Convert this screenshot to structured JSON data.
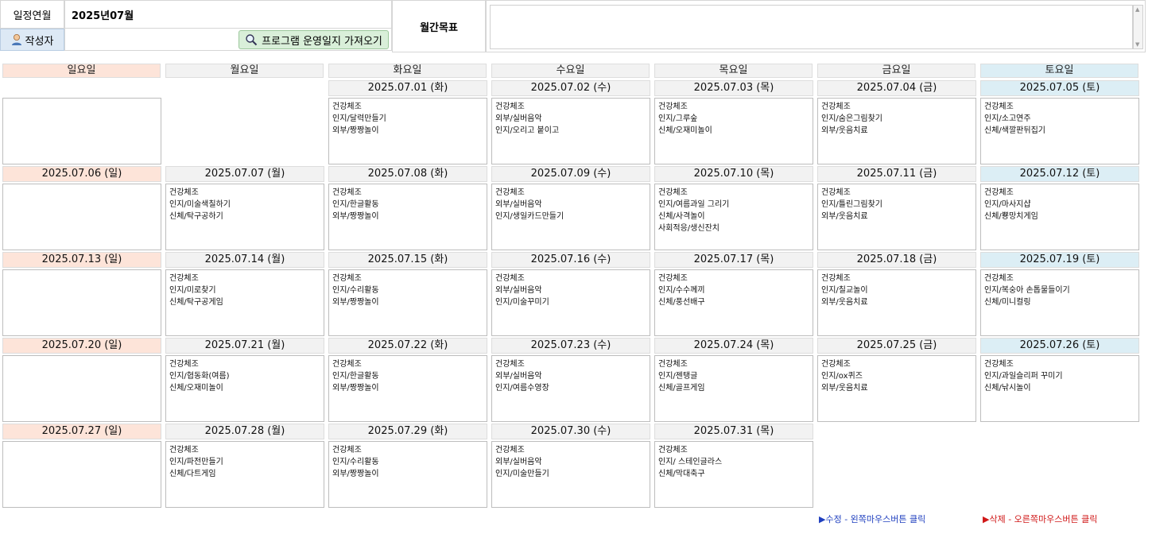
{
  "header": {
    "month_label": "일정연월",
    "month_value": "2025년07월",
    "author_button": "작성자",
    "author_value": "",
    "import_button": "프로그램 운영일지 가져오기",
    "goal_label": "월간목표",
    "goal_value": ""
  },
  "weekdays": [
    "일요일",
    "월요일",
    "화요일",
    "수요일",
    "목요일",
    "금요일",
    "토요일"
  ],
  "weeks": [
    [
      {
        "date": "",
        "items": []
      },
      {
        "date": "",
        "items": []
      },
      {
        "date": "2025.07.01 (화)",
        "items": [
          "건강체조",
          "인지/달력만들기",
          "외부/짱짱놀이"
        ]
      },
      {
        "date": "2025.07.02 (수)",
        "items": [
          "건강체조",
          "외부/실버음악",
          "인지/오리고 붙이고"
        ]
      },
      {
        "date": "2025.07.03 (목)",
        "items": [
          "건강체조",
          "인지/그루숲",
          "신체/오재미놀이"
        ]
      },
      {
        "date": "2025.07.04 (금)",
        "items": [
          "건강체조",
          "인지/숨은그림찾기",
          "외부/웃음치료"
        ]
      },
      {
        "date": "2025.07.05 (토)",
        "items": [
          "건강체조",
          "인지/소고연주",
          "신체/색깔판뒤집기"
        ]
      }
    ],
    [
      {
        "date": "2025.07.06 (일)",
        "items": []
      },
      {
        "date": "2025.07.07 (월)",
        "items": [
          "건강체조",
          "인지/미술색칠하기",
          "신체/탁구공하기"
        ]
      },
      {
        "date": "2025.07.08 (화)",
        "items": [
          "건강체조",
          "인지/한글활동",
          "외부/짱짱놀이"
        ]
      },
      {
        "date": "2025.07.09 (수)",
        "items": [
          "건강체조",
          "외부/실버음악",
          "인지/생일카드만들기"
        ]
      },
      {
        "date": "2025.07.10 (목)",
        "items": [
          "건강체조",
          "인지/여름과일 그리기",
          "신체/사격놀이",
          "사회적응/생신잔치"
        ]
      },
      {
        "date": "2025.07.11 (금)",
        "items": [
          "건강체조",
          "인지/틀린그림찾기",
          "외부/웃음치료"
        ]
      },
      {
        "date": "2025.07.12 (토)",
        "items": [
          "건강체조",
          "인지/마사지샵",
          "신체/뿅망치게임"
        ]
      }
    ],
    [
      {
        "date": "2025.07.13 (일)",
        "items": []
      },
      {
        "date": "2025.07.14 (월)",
        "items": [
          "건강체조",
          "인지/미로찾기",
          "신체/탁구공게임"
        ]
      },
      {
        "date": "2025.07.15 (화)",
        "items": [
          "건강체조",
          "인지/수리활동",
          "외부/짱짱놀이"
        ]
      },
      {
        "date": "2025.07.16 (수)",
        "items": [
          "건강체조",
          "외부/실버음악",
          "인지/미술꾸미기"
        ]
      },
      {
        "date": "2025.07.17 (목)",
        "items": [
          "건강체조",
          "인지/수수께끼",
          "신체/풍선배구"
        ]
      },
      {
        "date": "2025.07.18 (금)",
        "items": [
          "건강체조",
          "인지/칠교놀이",
          "외부/웃음치료"
        ]
      },
      {
        "date": "2025.07.19 (토)",
        "items": [
          "건강체조",
          "인지/복숭아 손톱물들이기",
          "신체/미니컬링"
        ]
      }
    ],
    [
      {
        "date": "2025.07.20 (일)",
        "items": []
      },
      {
        "date": "2025.07.21 (월)",
        "items": [
          "건강체조",
          "인지/협동화(여름)",
          "신체/오재미놀이"
        ]
      },
      {
        "date": "2025.07.22 (화)",
        "items": [
          "건강체조",
          "인지/한글활동",
          "외부/짱짱놀이"
        ]
      },
      {
        "date": "2025.07.23 (수)",
        "items": [
          "건강체조",
          "외부/실버음악",
          "인지/여름수영장"
        ]
      },
      {
        "date": "2025.07.24 (목)",
        "items": [
          "건강체조",
          "인지/젠탱글",
          "신체/골프게임"
        ]
      },
      {
        "date": "2025.07.25 (금)",
        "items": [
          "건강체조",
          "인지/ox퀴즈",
          "외부/웃음치료"
        ]
      },
      {
        "date": "2025.07.26 (토)",
        "items": [
          "건강체조",
          "인지/과일슬리퍼 꾸미기",
          "신체/낚시놀이"
        ]
      }
    ],
    [
      {
        "date": "2025.07.27 (일)",
        "items": []
      },
      {
        "date": "2025.07.28 (월)",
        "items": [
          "건강체조",
          "인지/파전만들기",
          "신체/다트게임"
        ]
      },
      {
        "date": "2025.07.29 (화)",
        "items": [
          "건강체조",
          "인지/수리활동",
          "외부/짱짱놀이"
        ]
      },
      {
        "date": "2025.07.30 (수)",
        "items": [
          "건강체조",
          "외부/실버음악",
          "인지/미술만들기"
        ]
      },
      {
        "date": "2025.07.31 (목)",
        "items": [
          "건강체조",
          "인지/ 스테인글라스",
          "신체/막대축구"
        ]
      }
    ]
  ],
  "footer": {
    "edit_hint": "수정 - 왼쪽마우스버튼 클릭",
    "delete_hint": "삭제 - 오른쪽마우스버튼 클릭"
  },
  "icons": {
    "author": "person-icon",
    "import": "magnifier-icon",
    "hint_marker": "triangle-right-icon"
  },
  "colors": {
    "sunday": "#fde4d9",
    "saturday": "#dceef5",
    "weekday": "#f2f2f2",
    "import_button": "#d9efd9",
    "edit_hint": "#1f3fbf",
    "delete_hint": "#d01818"
  }
}
